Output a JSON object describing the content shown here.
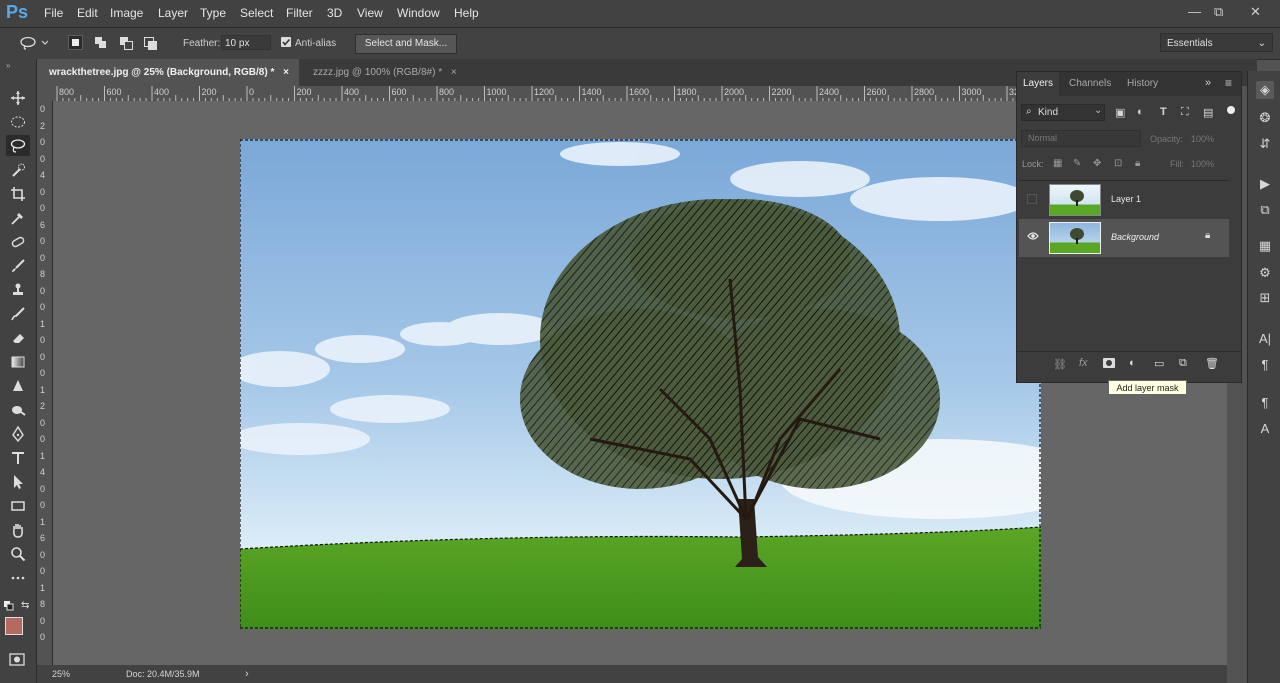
{
  "app": {
    "logo": "Ps"
  },
  "menu": [
    "File",
    "Edit",
    "Image",
    "Layer",
    "Type",
    "Select",
    "Filter",
    "3D",
    "View",
    "Window",
    "Help"
  ],
  "window_controls": {
    "minimize": "—",
    "restore": "⧉",
    "close": "✕"
  },
  "options": {
    "feather_label": "Feather:",
    "feather_value": "10 px",
    "antialias_label": "Anti-alias",
    "antialias_checked": true,
    "select_mask_label": "Select and Mask...",
    "workspace": "Essentials"
  },
  "tabs": [
    {
      "title": "wrackthetree.jpg @ 25% (Background, RGB/8) *",
      "close": "×",
      "active": true
    },
    {
      "title": "zzzz.jpg @ 100% (RGB/8#) *",
      "close": "×",
      "active": false
    }
  ],
  "ruler_top": [
    "800",
    "600",
    "400",
    "200",
    "0",
    "200",
    "400",
    "600",
    "800",
    "1000",
    "1200",
    "1400",
    "1600",
    "1800",
    "2000",
    "2200",
    "2400",
    "2600",
    "2800",
    "3000",
    "3200"
  ],
  "ruler_left": [
    "0",
    "2",
    "0",
    "0",
    "4",
    "0",
    "0",
    "6",
    "0",
    "0",
    "8",
    "0",
    "0",
    "1",
    "0",
    "0",
    "0",
    "1",
    "2",
    "0",
    "0",
    "1",
    "4",
    "0",
    "0",
    "1",
    "6",
    "0",
    "0",
    "1",
    "8",
    "0",
    "0"
  ],
  "status": {
    "zoom": "25%",
    "doc": "Doc: 20.4M/35.9M",
    "arrow": "›"
  },
  "layers_panel": {
    "tabs": [
      "Layers",
      "Channels",
      "History"
    ],
    "kind_label": "Kind",
    "blend_mode": "Normal",
    "opacity_label": "Opacity:",
    "opacity_value": "100%",
    "lock_label": "Lock:",
    "fill_label": "Fill:",
    "fill_value": "100%",
    "layers": [
      {
        "name": "Layer 1",
        "visible": false,
        "locked": false
      },
      {
        "name": "Background",
        "visible": true,
        "locked": true
      }
    ],
    "tooltip": "Add layer mask"
  },
  "colors": {
    "foreground": "#b46a61",
    "background": "#d77068",
    "accent": "#5aa9e6"
  }
}
